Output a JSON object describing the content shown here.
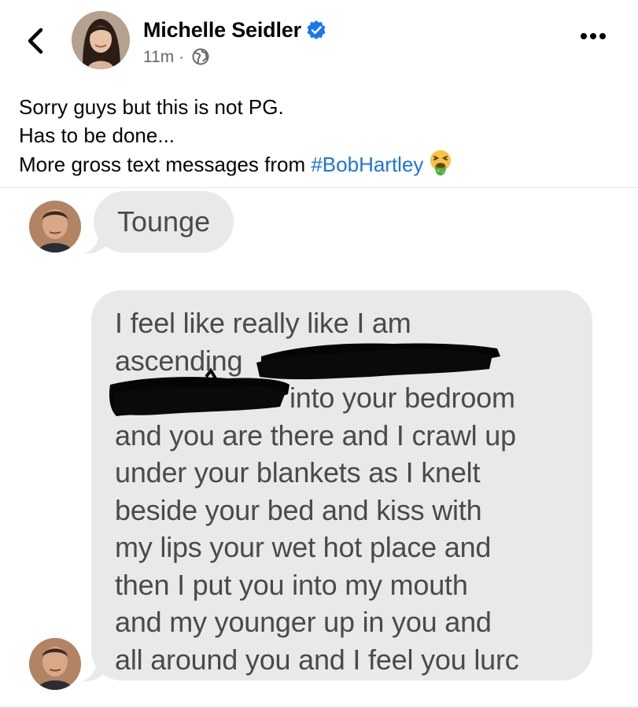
{
  "post": {
    "author": "Michelle Seidler",
    "time": "11m",
    "meta_separator": "·",
    "verified": true,
    "audience_icon": "globe-icon"
  },
  "caption": {
    "line1": "Sorry guys but this is not PG.",
    "line2": "Has to be done...",
    "line3_prefix": "More gross text messages from ",
    "hashtag": "#BobHartley",
    "emoji": "face-vomiting-emoji"
  },
  "messages": [
    {
      "text": "Tounge"
    },
    {
      "lines": [
        "I feel like really like I am",
        "ascending",
        "into your bedroom",
        "and you are there and I crawl up",
        "under your blankets as I knelt",
        "beside your bed and kiss with",
        "my lips your wet hot place and",
        "then I put you into my mouth",
        "and my younger up in you and",
        "all around you and I feel you lurc"
      ]
    }
  ],
  "colors": {
    "hashtag": "#1b74e4",
    "verified_badge": "#1877f2",
    "bubble": "#e9e9eb",
    "bubble_text": "#4a4a4c",
    "meta_text": "#65676b",
    "redaction": "#000000"
  },
  "icons": {
    "back": "chevron-left-icon",
    "more": "more-dots-icon",
    "verified": "verified-badge-icon",
    "audience": "globe-icon"
  }
}
